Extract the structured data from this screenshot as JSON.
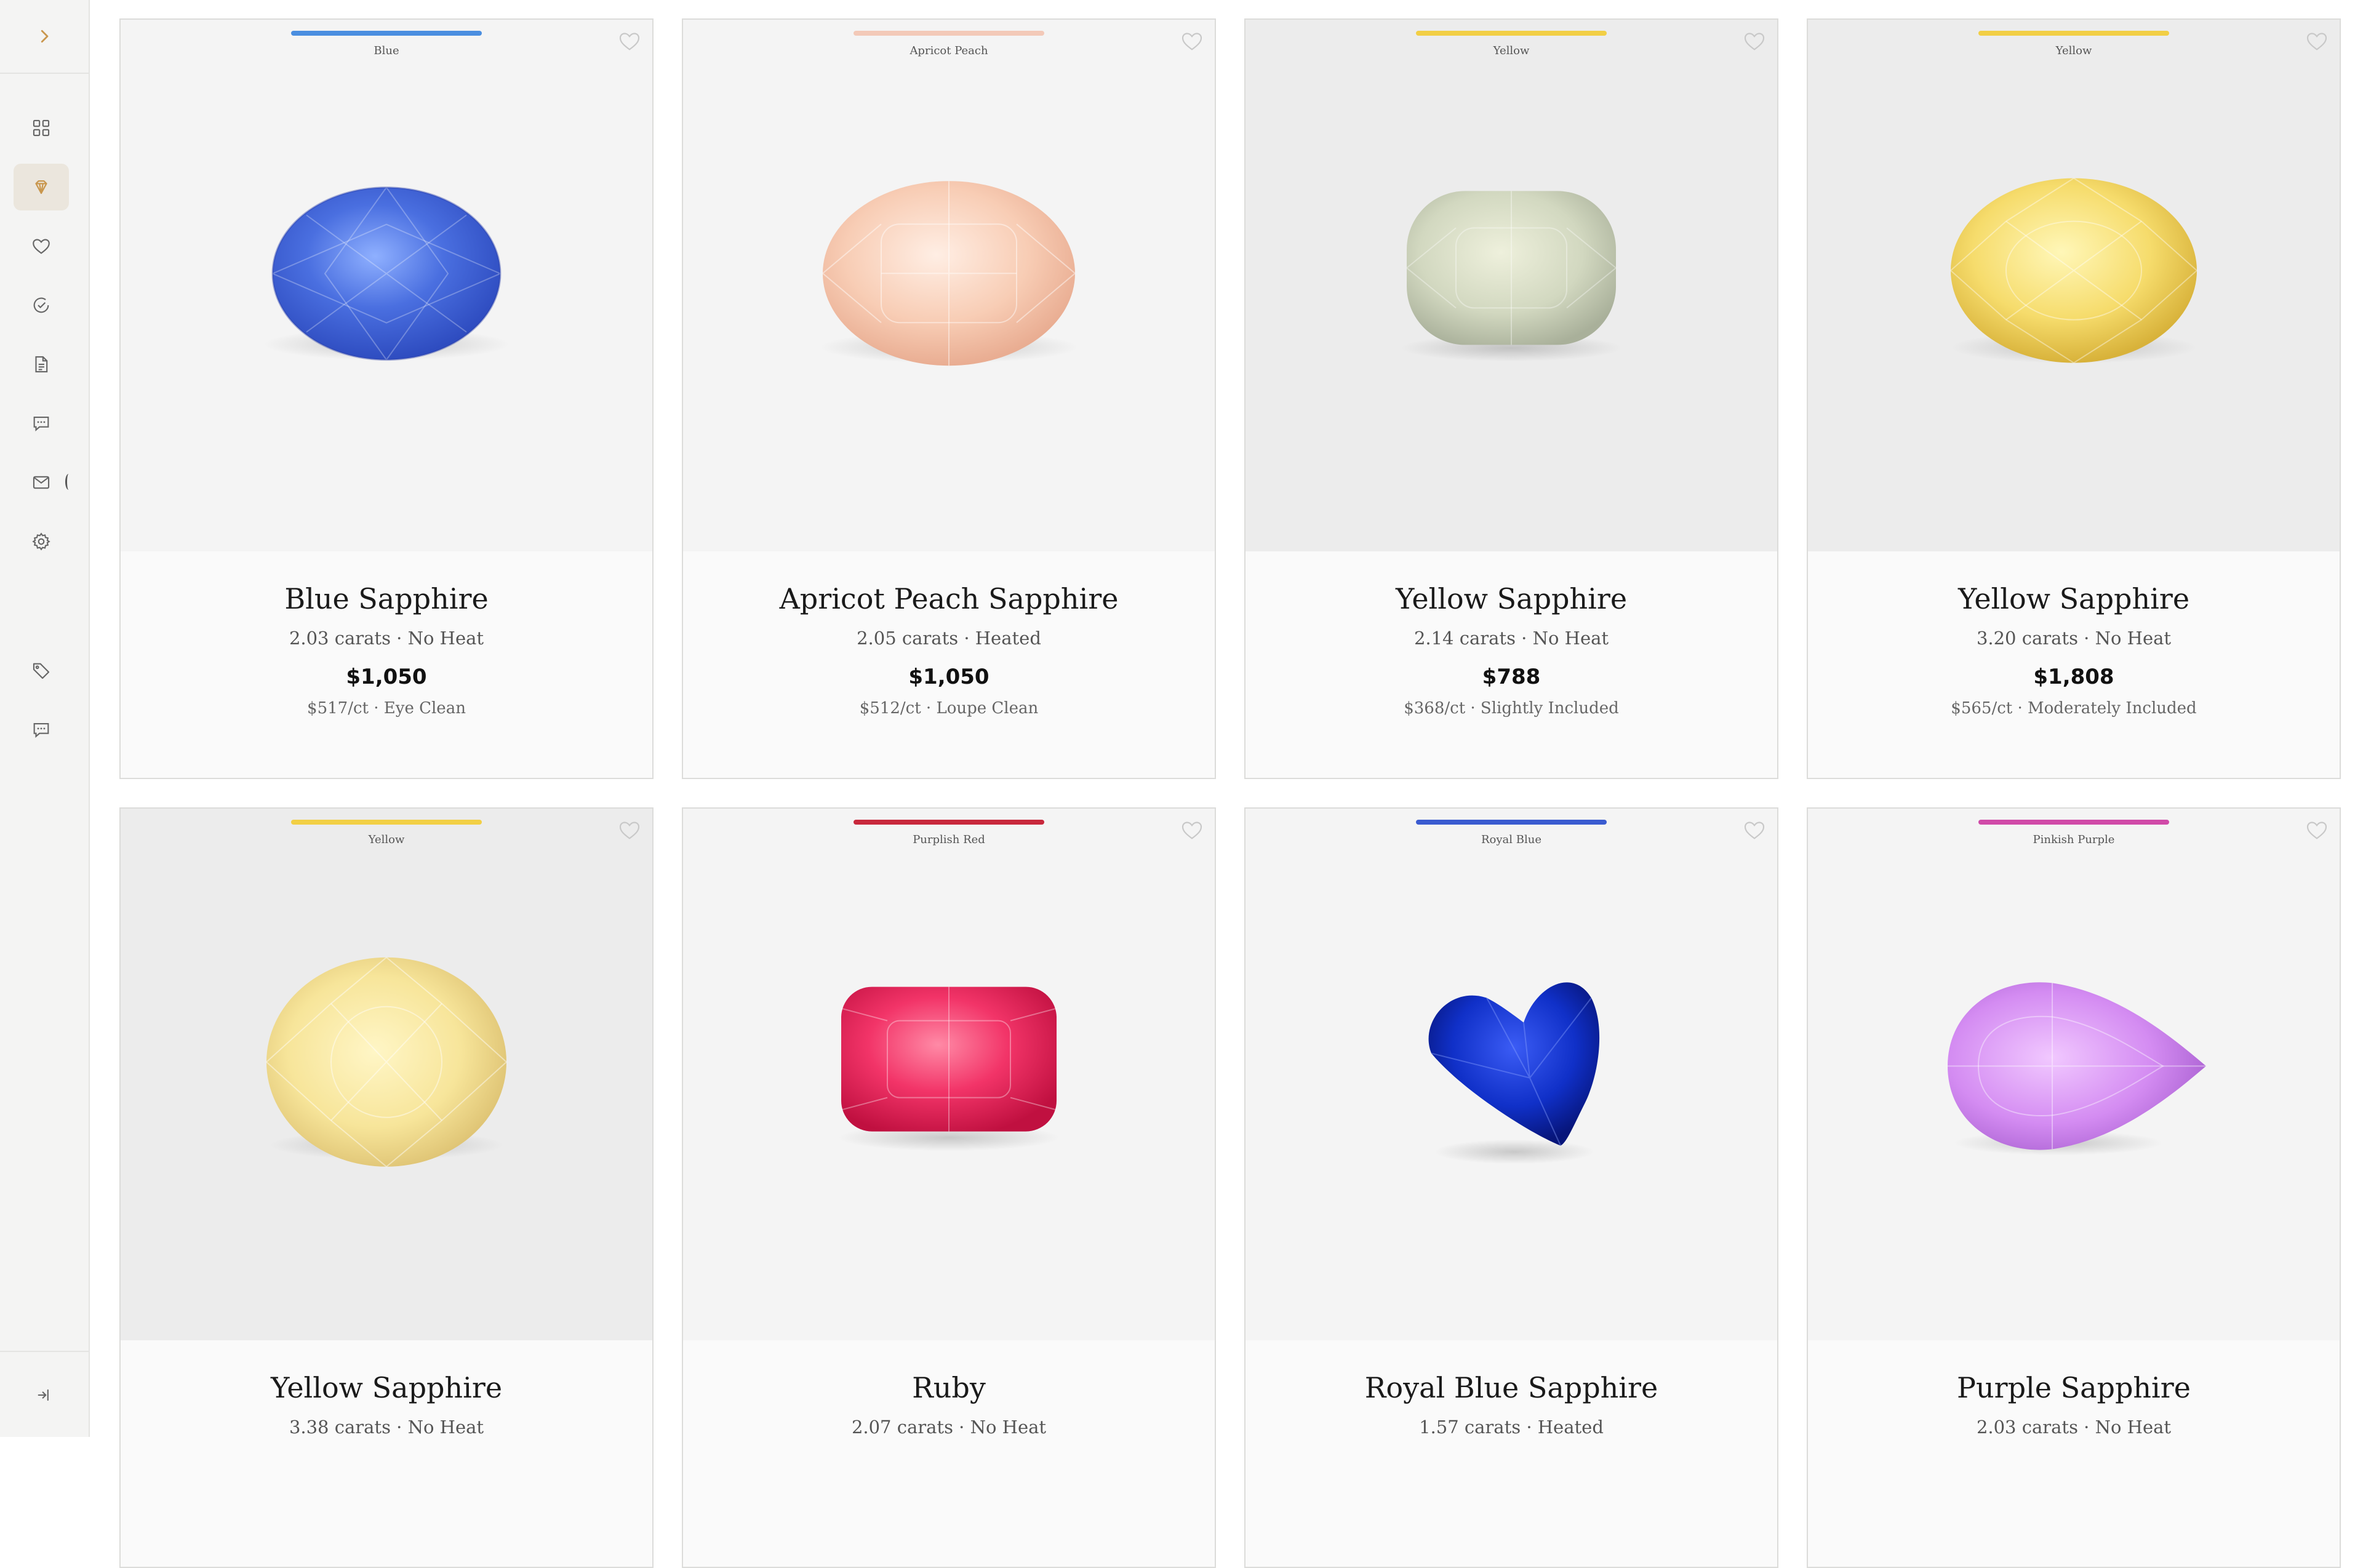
{
  "sidebar": {
    "items": [
      {
        "name": "grid-icon"
      },
      {
        "name": "gem-icon",
        "active": true
      },
      {
        "name": "heart-icon"
      },
      {
        "name": "check-circle-icon"
      },
      {
        "name": "document-icon"
      },
      {
        "name": "chat-icon"
      },
      {
        "name": "mail-icon"
      },
      {
        "name": "settings-icon"
      },
      {
        "name": "tag-icon"
      },
      {
        "name": "chat-icon"
      }
    ],
    "accent": "#c9974e"
  },
  "cards": [
    {
      "color_label": "Blue",
      "color_hex": "#4a8ee0",
      "title": "Blue Sapphire",
      "specs": "2.03 carats · No Heat",
      "price": "$1,050",
      "per_carat": "$517/ct · Eye Clean",
      "gem": "blue-oval"
    },
    {
      "color_label": "Apricot Peach",
      "color_hex": "#f3c9b8",
      "title": "Apricot Peach Sapphire",
      "specs": "2.05 carats · Heated",
      "price": "$1,050",
      "per_carat": "$512/ct · Loupe Clean",
      "gem": "peach-oval"
    },
    {
      "color_label": "Yellow",
      "color_hex": "#f2cf45",
      "title": "Yellow Sapphire",
      "specs": "2.14 carats · No Heat",
      "price": "$788",
      "per_carat": "$368/ct · Slightly Included",
      "gem": "pale-cushion"
    },
    {
      "color_label": "Yellow",
      "color_hex": "#f2cf45",
      "title": "Yellow Sapphire",
      "specs": "3.20 carats · No Heat",
      "price": "$1,808",
      "per_carat": "$565/ct · Moderately Included",
      "gem": "yellow-oval"
    },
    {
      "color_label": "Yellow",
      "color_hex": "#f2cf45",
      "title": "Yellow Sapphire",
      "specs": "3.38 carats · No Heat",
      "gem": "pale-yellow-round"
    },
    {
      "color_label": "Purplish Red",
      "color_hex": "#c8283c",
      "title": "Ruby",
      "specs": "2.07 carats · No Heat",
      "gem": "ruby-cushion"
    },
    {
      "color_label": "Royal Blue",
      "color_hex": "#3a5bd0",
      "title": "Royal Blue Sapphire",
      "specs": "1.57 carats · Heated",
      "gem": "royal-heart"
    },
    {
      "color_label": "Pinkish Purple",
      "color_hex": "#d04aa8",
      "title": "Purple Sapphire",
      "specs": "2.03 carats · No Heat",
      "gem": "purple-pear"
    }
  ]
}
